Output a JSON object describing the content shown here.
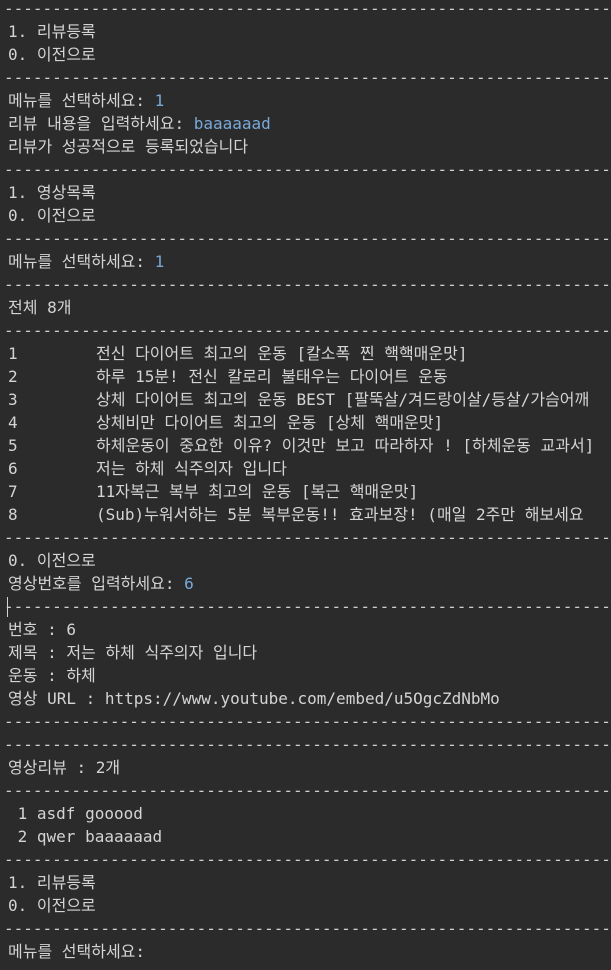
{
  "separator": "------------------------------------------------------------------------------------------",
  "menu_review": {
    "item1": "1. 리뷰등록",
    "item0": "0. 이전으로"
  },
  "prompt_menu": "메뉴를 선택하세요: ",
  "input_menu_1": "1",
  "prompt_review": "리뷰 내용을 입력하세요: ",
  "input_review": "baaaaaad",
  "review_success": "리뷰가 성공적으로 등록되었습니다",
  "menu_video": {
    "item1": "1. 영상목록",
    "item0": "0. 이전으로"
  },
  "input_menu_2": "1",
  "total": "전체 8개",
  "videos": [
    {
      "no": "1",
      "title": "전신 다이어트 최고의 운동 [칼소폭 찐 핵핵매운맛]"
    },
    {
      "no": "2",
      "title": "하루 15분! 전신 칼로리 불태우는 다이어트 운동"
    },
    {
      "no": "3",
      "title": "상체 다이어트 최고의 운동 BEST [팔뚝살/겨드랑이살/등살/가슴어깨"
    },
    {
      "no": "4",
      "title": "상체비만 다이어트 최고의 운동 [상체 핵매운맛]"
    },
    {
      "no": "5",
      "title": "하체운동이 중요한 이유? 이것만 보고 따라하자 ! [하체운동 교과서]"
    },
    {
      "no": "6",
      "title": "저는 하체 식주의자 입니다"
    },
    {
      "no": "7",
      "title": "11자복근 복부 최고의 운동 [복근 핵매운맛]"
    },
    {
      "no": "8",
      "title": "(Sub)누워서하는 5분 복부운동!! 효과보장! (매일 2주만 해보세요"
    }
  ],
  "back": "0. 이전으로",
  "prompt_video_no": "영상번호를 입력하세요: ",
  "input_video_no": "6",
  "detail": {
    "no": "번호 : 6",
    "title": "제목 : 저는 하체 식주의자 입니다",
    "exercise": "운동 : 하체",
    "url": "영상 URL : https://www.youtube.com/embed/u5OgcZdNbMo"
  },
  "review_count": "영상리뷰 : 2개",
  "reviews": [
    " 1 asdf gooood",
    " 2 qwer baaaaaad"
  ],
  "menu_review_2": {
    "item1": "1. 리뷰등록",
    "item0": "0. 이전으로"
  },
  "prompt_final": "메뉴를 선택하세요:"
}
